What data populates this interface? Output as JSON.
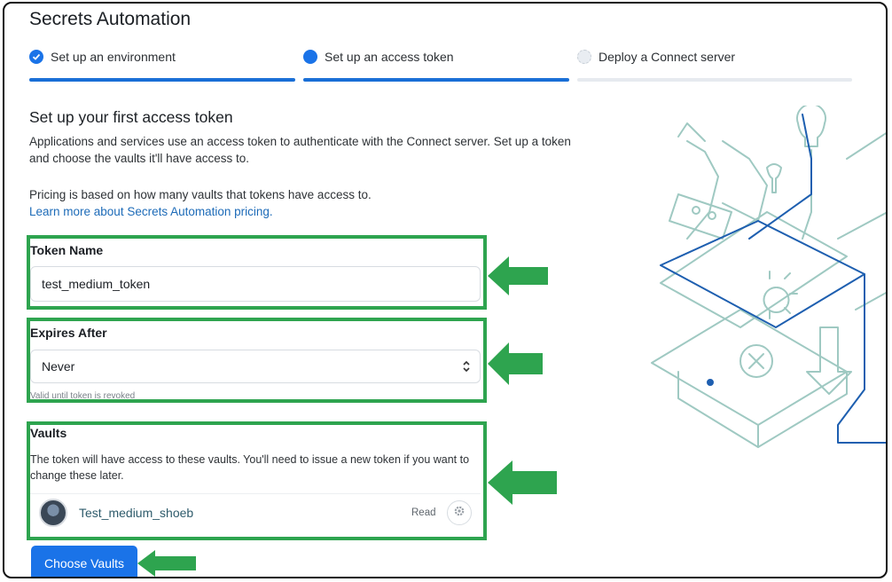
{
  "page": {
    "title": "Secrets Automation"
  },
  "stepper": {
    "steps": [
      {
        "label": "Set up an environment",
        "state": "done"
      },
      {
        "label": "Set up an access token",
        "state": "active"
      },
      {
        "label": "Deploy a Connect server",
        "state": "pending"
      }
    ]
  },
  "section": {
    "heading": "Set up your first access token",
    "intro_line1": "Applications and services use an access token to authenticate with the Connect server. Set up a token",
    "intro_line2": "and choose the vaults it'll have access to.",
    "pricing_text": "Pricing is based on how many vaults that tokens have access to.",
    "pricing_link": "Learn more about Secrets Automation pricing."
  },
  "token_name": {
    "label": "Token Name",
    "value": "test_medium_token"
  },
  "expires_after": {
    "label": "Expires After",
    "value": "Never",
    "hint": "Valid until token is revoked"
  },
  "vaults": {
    "label": "Vaults",
    "desc_line1": "The token will have access to these vaults. You'll need to issue a new token if you want to",
    "desc_line2": "change these later.",
    "items": [
      {
        "name": "Test_medium_shoeb",
        "permission": "Read"
      }
    ]
  },
  "actions": {
    "choose_vaults": "Choose Vaults"
  },
  "colors": {
    "accent": "#1a73e8",
    "highlight": "#2ea44f",
    "illustration": "#9fc9c2",
    "illustration_dark": "#1e5fb0"
  }
}
